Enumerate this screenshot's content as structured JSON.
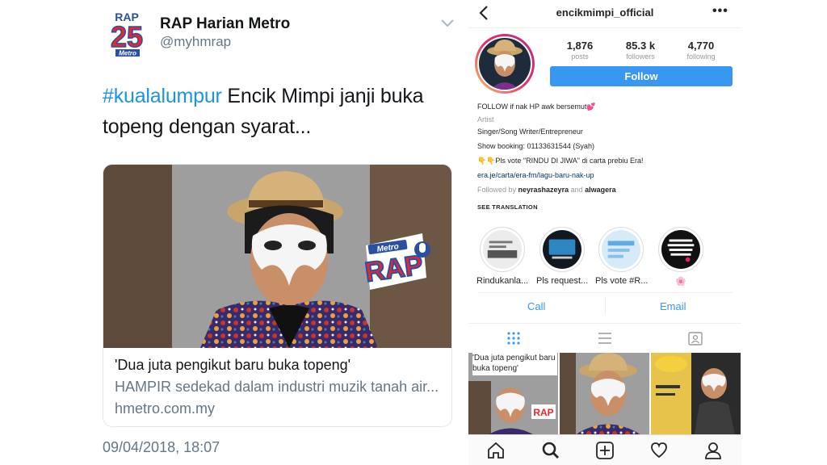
{
  "tweet": {
    "name": "RAP Harian Metro",
    "handle": "@myhmrap",
    "hashtag": "#kualalumpur",
    "text": " Encik Mimpi janji buka topeng dengan syarat...",
    "logo_text": "RAP",
    "logo_number": "25",
    "logo_sub": "Metro",
    "card": {
      "badge_top": "Metro",
      "badge_main": "RAP",
      "title": "'Dua juta pengikut baru buka topeng'",
      "description": "HAMPIR sedekad dalam industri muzik tanah air...",
      "domain": "hmetro.com.my"
    },
    "timestamp": "09/04/2018, 18:07"
  },
  "instagram": {
    "username": "encikmimpi_official",
    "more": "•••",
    "stats": {
      "posts_value": "1,876",
      "posts_label": "posts",
      "followers_value": "85.3 k",
      "followers_label": "followers",
      "following_value": "4,770",
      "following_label": "following"
    },
    "follow_label": "Follow",
    "bio": {
      "line1": "FOLLOW if nak HP awk bersemut💕",
      "category": "Artist",
      "line3": "Singer/Song Writer/Entrepreneur",
      "line4": "Show booking: 01133631544 (Syah)",
      "line5": "👇👇Pls vote \"RINDU DI JIWA\" di carta prebiu Era!",
      "link": "era.je/carta/era-fm/lagu-baru-nak-up",
      "followed_prefix": "Followed by ",
      "followed_user1": "neyrashazeyra",
      "followed_and": " and ",
      "followed_user2": "alwagera",
      "see_translation": "SEE TRANSLATION"
    },
    "highlights": [
      {
        "label": "Rindukanla..."
      },
      {
        "label": "Pls request..."
      },
      {
        "label": "Pls vote #R..."
      },
      {
        "label": "🌸"
      }
    ],
    "call_label": "Call",
    "email_label": "Email",
    "grid_post1_caption": "'Dua juta pengikut baru buka topeng'",
    "colors": {
      "accent": "#3897f0",
      "link": "#1b95e0"
    }
  }
}
